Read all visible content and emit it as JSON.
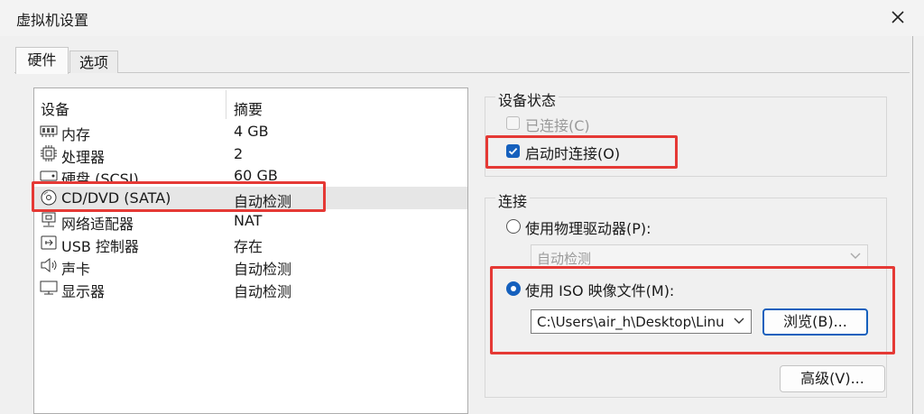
{
  "window": {
    "title": "虚拟机设置"
  },
  "tabs": [
    {
      "label": "硬件"
    },
    {
      "label": "选项"
    }
  ],
  "hardware": {
    "columns": {
      "device": "设备",
      "summary": "摘要"
    },
    "items": [
      {
        "icon": "memory-icon",
        "name": "内存",
        "summary": "4 GB"
      },
      {
        "icon": "processor-icon",
        "name": "处理器",
        "summary": "2"
      },
      {
        "icon": "hard-disk-icon",
        "name": "硬盘 (SCSI)",
        "summary": "60 GB"
      },
      {
        "icon": "cd-dvd-icon",
        "name": "CD/DVD (SATA)",
        "summary": "自动检测",
        "selected": true
      },
      {
        "icon": "network-adapter-icon",
        "name": "网络适配器",
        "summary": "NAT"
      },
      {
        "icon": "usb-controller-icon",
        "name": "USB 控制器",
        "summary": "存在"
      },
      {
        "icon": "sound-card-icon",
        "name": "声卡",
        "summary": "自动检测"
      },
      {
        "icon": "display-icon",
        "name": "显示器",
        "summary": "自动检测"
      }
    ]
  },
  "device_status": {
    "legend": "设备状态",
    "connected": {
      "label": "已连接(C)",
      "checked": false,
      "enabled": false
    },
    "connect_at_power_on": {
      "label": "启动时连接(O)",
      "checked": true,
      "enabled": true
    }
  },
  "connection": {
    "legend": "连接",
    "physical_drive": {
      "label": "使用物理驱动器(P):",
      "selected": false,
      "dropdown_value": "自动检测"
    },
    "iso_image": {
      "label": "使用 ISO 映像文件(M):",
      "selected": true,
      "path_value": "C:\\Users\\air_h\\Desktop\\Linu"
    },
    "browse_label": "浏览(B)..."
  },
  "advanced_label": "高级(V)...",
  "colors": {
    "accent": "#1560bd",
    "annotation": "#e53935"
  }
}
